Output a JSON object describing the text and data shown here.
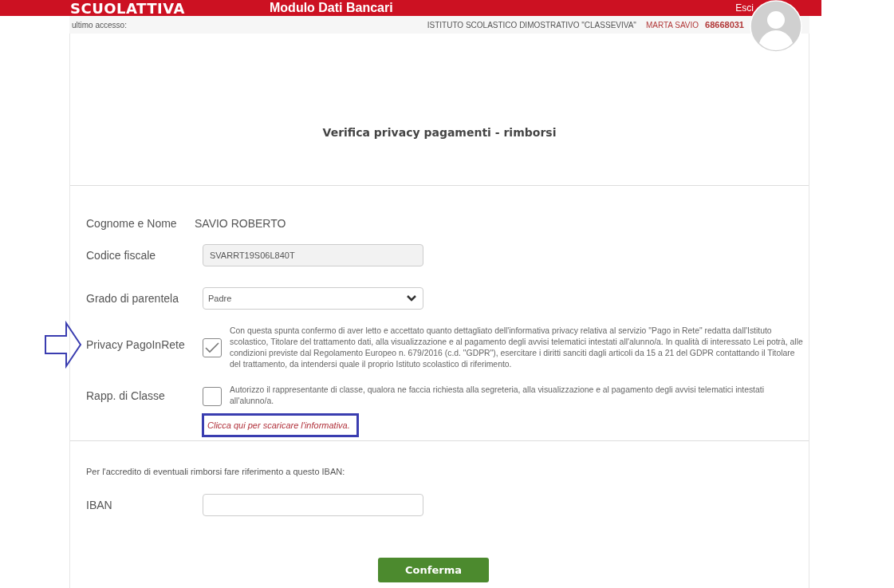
{
  "header": {
    "logo": "SCUOLATTIVA",
    "title": "Modulo Dati Bancari",
    "logout": "Esci"
  },
  "subbar": {
    "last_access": "ultimo accesso:",
    "school": "ISTITUTO SCOLASTICO DIMOSTRATIVO \"CLASSEVIVA\"",
    "user": "MARTA SAVIO",
    "code": "68668031"
  },
  "form": {
    "title": "Verifica privacy pagamenti - rimborsi",
    "fields": [
      {
        "kind": "text",
        "label": "Cognome e Nome",
        "value": "SAVIO ROBERTO"
      },
      {
        "kind": "input",
        "label": "Codice fiscale",
        "value": "SVARRT19S06L840T",
        "disabled": true
      },
      {
        "kind": "select",
        "label": "Grado di parentela",
        "value": "Padre"
      }
    ],
    "consents": [
      {
        "label": "Privacy PagoInRete",
        "checked": true,
        "annotated": true,
        "text": "Con questa spunta confermo di aver letto e accettato quanto dettagliato dell'informativa privacy relativa al servizio \"Pago in Rete\" redatta dall'Istituto scolastico, Titolare del trattamento dati, alla visualizzazione e al pagamento degli avvisi telematici intestati all'alunno/a. In qualità di interessato Lei potrà, alle condizioni previste dal Regolamento Europeo n. 679/2016 (c.d. \"GDPR\"), esercitare i diritti sanciti dagli articoli da 15 a 21 del GDPR contattando il Titolare del trattamento, da intendersi quale il proprio Istituto scolastico di riferimento."
      },
      {
        "label": "Rapp. di Classe",
        "checked": false,
        "annotated": false,
        "text": "Autorizzo il rappresentante di classe, qualora ne faccia richiesta alla segreteria, alla visualizzazione e al pagamento degli avvisi telematici intestati all'alunno/a."
      }
    ],
    "info_link": {
      "text": "Clicca qui per scaricare l'informativa.",
      "highlighted": true
    },
    "iban_note": "Per l'accredito di eventuali rimborsi fare riferimento a questo IBAN:",
    "iban": {
      "label": "IBAN"
    },
    "submit": "Conferma"
  }
}
